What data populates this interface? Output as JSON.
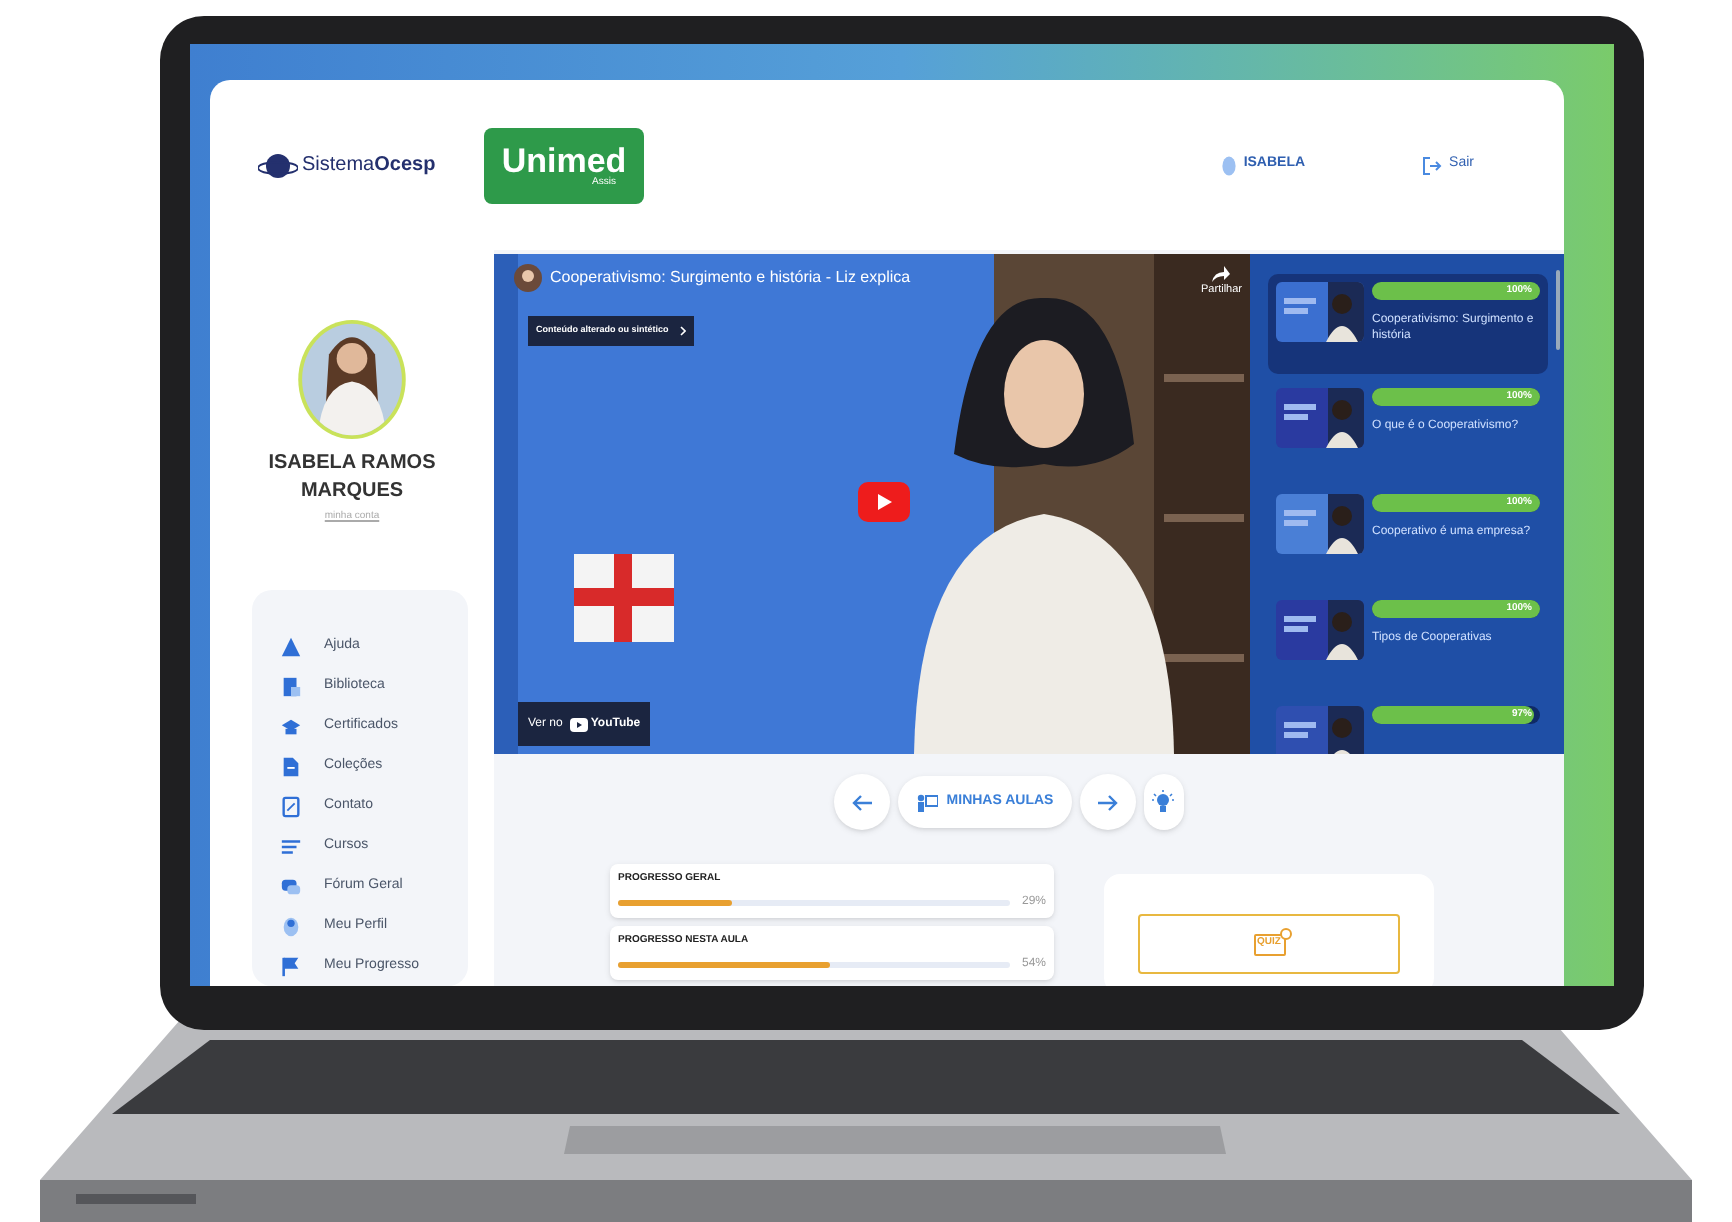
{
  "header": {
    "logo": "Sistema**Ocesp**",
    "brand": {
      "name": "Unimed",
      "city": "Assis"
    },
    "user": "ISABELA",
    "logout": "Sair"
  },
  "sidebar": {
    "name": "ISABELA RAMOS MARQUES",
    "account_link": "minha conta",
    "menu": [
      {
        "label": "Ajuda"
      },
      {
        "label": "Biblioteca"
      },
      {
        "label": "Certificados"
      },
      {
        "label": "Coleções"
      },
      {
        "label": "Contato"
      },
      {
        "label": "Cursos"
      },
      {
        "label": "Fórum Geral"
      },
      {
        "label": "Meu Perfil"
      },
      {
        "label": "Meu Progresso"
      }
    ]
  },
  "player": {
    "title": "Cooperativismo: Surgimento e história - Liz explica",
    "badge": "Conteúdo alterado ou sintético",
    "share": "Partilhar",
    "watch_on": "Ver no",
    "platform": "YouTube"
  },
  "playlist": [
    {
      "title": "Cooperativismo: Surgimento e história",
      "progress": "100%",
      "level": 1,
      "selected": true
    },
    {
      "title": "O que é o Cooperativismo?",
      "progress": "100%",
      "level": 1,
      "selected": false
    },
    {
      "title": "Cooperativo é uma empresa?",
      "progress": "100%",
      "level": 1,
      "selected": false
    },
    {
      "title": "Tipos de Cooperativas",
      "progress": "100%",
      "level": 1,
      "selected": false
    },
    {
      "progress": "97%",
      "level": 0.97,
      "selected": false
    }
  ],
  "nav": {
    "lessons": "MINHAS AULAS"
  },
  "progress": [
    {
      "label": "PROGRESSO GERAL",
      "value": "29%",
      "level": 0.29
    },
    {
      "label": "PROGRESSO NESTA AULA",
      "value": "54%",
      "level": 0.54
    }
  ],
  "quiz": {
    "icon_text": "QUIZ"
  }
}
